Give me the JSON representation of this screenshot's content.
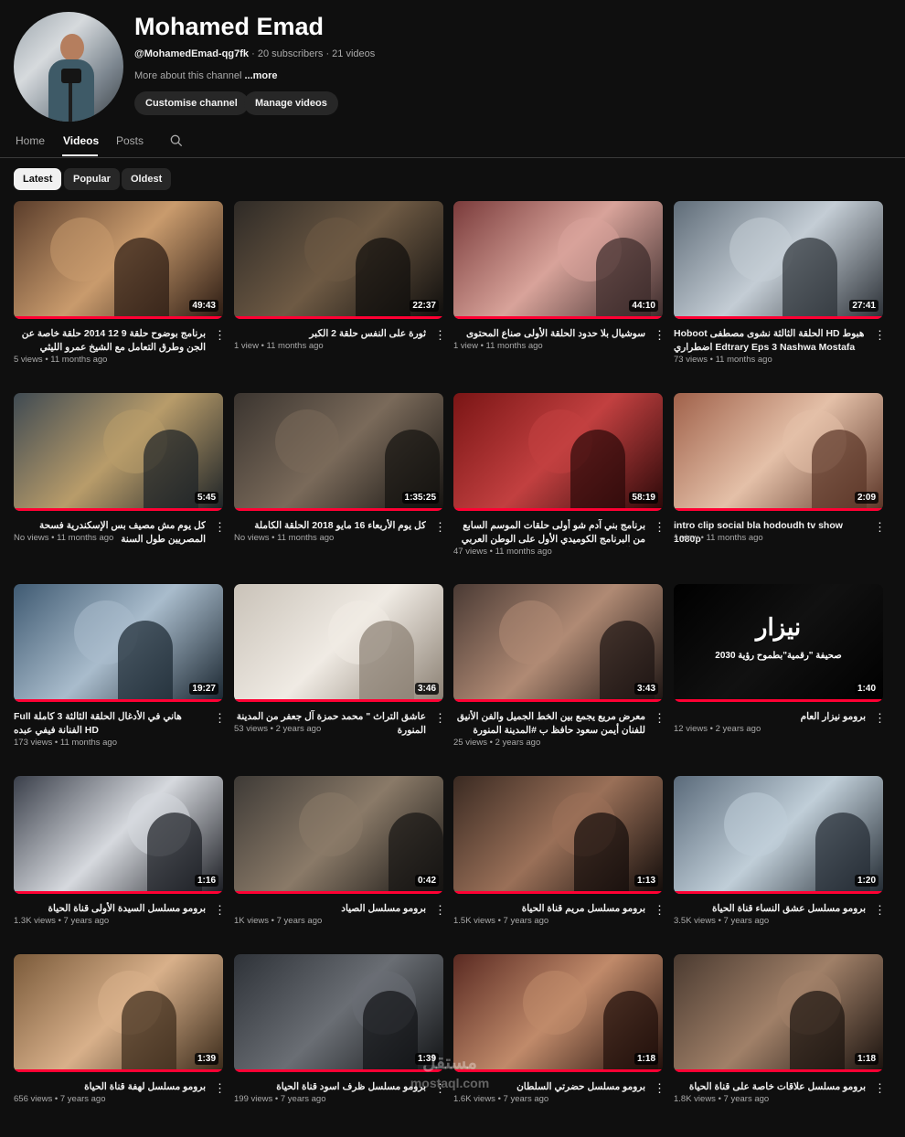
{
  "channel": {
    "name": "Mohamed Emad",
    "handle": "@MohamedEmad-qg7fk",
    "subscribers": "20 subscribers",
    "videos_count": "21 videos",
    "about": "More about this channel",
    "about_more": "...more",
    "customise_label": "Customise channel",
    "manage_label": "Manage videos"
  },
  "tabs": [
    {
      "label": "Home"
    },
    {
      "label": "Videos"
    },
    {
      "label": "Posts"
    }
  ],
  "chips": [
    {
      "label": "Latest"
    },
    {
      "label": "Popular"
    },
    {
      "label": "Oldest"
    }
  ],
  "icons": {
    "search": "search-icon",
    "menu": "more-vert-icon"
  },
  "colors": {
    "background": "#0f0f0f",
    "accent": "#ff0033",
    "chip": "#272727"
  },
  "videos": [
    {
      "title": "برنامج بوضوح حلقة 9 12 2014 حلقة خاصة عن الجن وطرق التعامل مع الشيخ عمرو الليثي Bwodoh",
      "views": "5 views",
      "age": "11 months ago",
      "duration": "49:43"
    },
    {
      "title": "ثورة على النفس حلقة 2 الكبر",
      "views": "1 view",
      "age": "11 months ago",
      "duration": "22:37"
    },
    {
      "title": "سوشيال بلا حدود الحلقة الأولى صناع المحتوى",
      "views": "1 view",
      "age": "11 months ago",
      "duration": "44:10"
    },
    {
      "title": "Hoboot الحلقة الثالثة نشوى مصطفى HD هبوط اضطراري Edtrary Eps 3 Nashwa Mostafa",
      "views": "73 views",
      "age": "11 months ago",
      "duration": "27:41"
    },
    {
      "title": "كل يوم مش مصيف بس الإسكندرية فسحة المصريين طول السنة",
      "views": "No views",
      "age": "11 months ago",
      "duration": "5:45"
    },
    {
      "title": "كل يوم الأربعاء 16 مايو 2018 الحلقة الكاملة",
      "views": "No views",
      "age": "11 months ago",
      "duration": "1:35:25"
    },
    {
      "title": "برنامج بني آدم شو أولى حلقات الموسم السابع من البرنامج الكوميدي الأول على الوطن العربي بني آدم شو",
      "views": "47 views",
      "age": "11 months ago",
      "duration": "58:19"
    },
    {
      "title": "intro clip social bla hodoudh tv show 1080p",
      "views": "1 view",
      "age": "11 months ago",
      "duration": "2:09"
    },
    {
      "title": "Full هاني في الأدغال الحلقة الثالثة 3 كاملة الفنانة فيفي عبده HD",
      "views": "173 views",
      "age": "11 months ago",
      "duration": "19:27"
    },
    {
      "title": "عاشق التراث \" محمد حمزة آل جعفر من المدينة المنورة",
      "views": "53 views",
      "age": "2 years ago",
      "duration": "3:46"
    },
    {
      "title": "معرض مريع يجمع بين الخط الجميل والفن الأنيق للفنان أيمن سعود حافظ ب #المدينة المنورة",
      "views": "25 views",
      "age": "2 years ago",
      "duration": "3:43"
    },
    {
      "title": "برومو نيزار العام",
      "views": "12 views",
      "age": "2 years ago",
      "duration": "1:40"
    },
    {
      "title": "برومو مسلسل السيدة الأولى قناة الحياة",
      "views": "1.3K views",
      "age": "7 years ago",
      "duration": "1:16"
    },
    {
      "title": "برومو مسلسل الصياد",
      "views": "1K views",
      "age": "7 years ago",
      "duration": "0:42"
    },
    {
      "title": "برومو مسلسل مريم قناة الحياة",
      "views": "1.5K views",
      "age": "7 years ago",
      "duration": "1:13"
    },
    {
      "title": "برومو مسلسل عشق النساء قناة الحياة",
      "views": "3.5K views",
      "age": "7 years ago",
      "duration": "1:20"
    },
    {
      "title": "برومو مسلسل لهفة قناة الحياة",
      "views": "656 views",
      "age": "7 years ago",
      "duration": "1:39"
    },
    {
      "title": "برومو مسلسل ظرف اسود قناة الحياة",
      "views": "199 views",
      "age": "7 years ago",
      "duration": "1:39"
    },
    {
      "title": "برومو مسلسل حضرتي السلطان",
      "views": "1.6K views",
      "age": "7 years ago",
      "duration": "1:18"
    },
    {
      "title": "برومو مسلسل علاقات خاصة على قناة الحياة",
      "views": "1.8K views",
      "age": "7 years ago",
      "duration": "1:18"
    }
  ],
  "thumb_text": {
    "nizar_logo": "نيزار",
    "nizar_sub": "صحيفة \"رقمية\"بطموح رؤية 2030"
  },
  "watermark": {
    "line1": "مستقل",
    "line2": "mostaql.com"
  }
}
